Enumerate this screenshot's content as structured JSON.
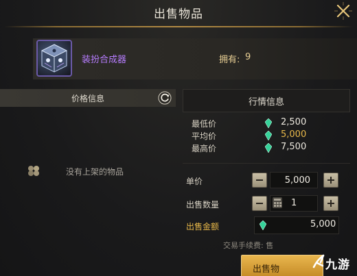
{
  "header": {
    "title": "出售物品"
  },
  "item": {
    "name": "装扮合成器",
    "owned_label": "拥有:",
    "owned_value": "9"
  },
  "price_info": {
    "title": "价格信息",
    "empty_text": "没有上架的物品"
  },
  "market": {
    "title": "行情信息",
    "rows": [
      {
        "label": "最低价",
        "value": "2,500"
      },
      {
        "label": "平均价",
        "value": "5,000"
      },
      {
        "label": "最高价",
        "value": "7,500"
      }
    ]
  },
  "form": {
    "unit_price_label": "单价",
    "unit_price_value": "5,000",
    "quantity_label": "出售数量",
    "quantity_value": "1",
    "total_label": "出售金额",
    "total_value": "5,000",
    "fee_text": "交易手续费: 售"
  },
  "sell_button": {
    "label": "出售物"
  },
  "watermark": {
    "text": "九游"
  },
  "colors": {
    "accent_gold": "#e9b94a",
    "item_name_purple": "#b77dff",
    "gem_green": "#35d39a"
  },
  "icons": [
    "close-icon",
    "item-box-icon",
    "refresh-icon",
    "empty-box-icon",
    "gem-icon",
    "calculator-icon",
    "minus-icon",
    "plus-icon",
    "jiuyou-logo-icon"
  ]
}
